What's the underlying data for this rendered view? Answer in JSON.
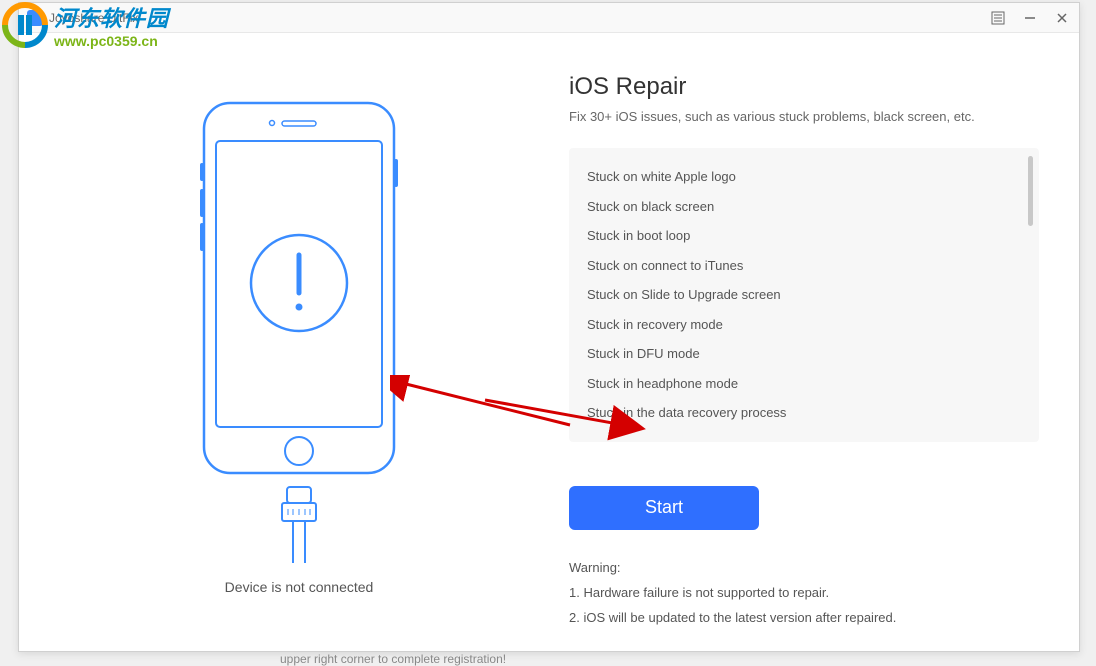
{
  "window": {
    "title": "Joyoshare UltFix"
  },
  "watermark": {
    "title": "河东软件园",
    "url": "www.pc0359.cn"
  },
  "device": {
    "status": "Device is not connected"
  },
  "repair": {
    "title": "iOS Repair",
    "subtitle": "Fix 30+ iOS issues, such as various stuck problems, black screen, etc.",
    "issues": [
      "Stuck on white Apple logo",
      "Stuck on black screen",
      "Stuck in boot loop",
      "Stuck on connect to iTunes",
      "Stuck on Slide to Upgrade screen",
      "Stuck in recovery mode",
      "Stuck in DFU mode",
      "Stuck in headphone mode",
      "Stuck in the data recovery process"
    ],
    "start_button": "Start",
    "warning_label": "Warning:",
    "warning_items": [
      "1. Hardware failure is not supported to repair.",
      "2. iOS will be updated to the latest version after repaired."
    ]
  },
  "footer_text": "upper right corner to complete registration!"
}
